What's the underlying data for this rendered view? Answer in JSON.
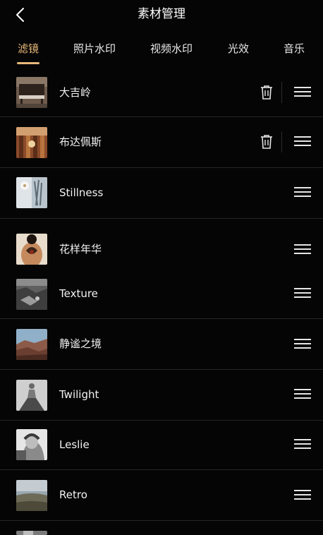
{
  "header": {
    "title": "素材管理"
  },
  "tabs": [
    {
      "label": "滤镜",
      "active": true
    },
    {
      "label": "照片水印",
      "active": false
    },
    {
      "label": "视频水印",
      "active": false
    },
    {
      "label": "光效",
      "active": false
    },
    {
      "label": "音乐",
      "active": false
    }
  ],
  "colors": {
    "accent": "#e8b87a",
    "background": "#050505",
    "divider": "#262626"
  },
  "filters": [
    {
      "name": "大吉岭",
      "deletable": true,
      "thumb": "piano-icon"
    },
    {
      "name": "布达佩斯",
      "deletable": true,
      "thumb": "ornate-hall-icon"
    },
    {
      "name": "Stillness",
      "deletable": false,
      "thumb": "snowy-tree-icon"
    },
    {
      "name": "花样年华",
      "deletable": false,
      "thumb": "tattooed-back-icon"
    },
    {
      "name": "Texture",
      "deletable": false,
      "thumb": "rocky-ground-icon"
    },
    {
      "name": "静谧之境",
      "deletable": false,
      "thumb": "desert-hills-icon"
    },
    {
      "name": "Twilight",
      "deletable": false,
      "thumb": "woman-gown-icon"
    },
    {
      "name": "Leslie",
      "deletable": false,
      "thumb": "bw-portrait-icon"
    },
    {
      "name": "Retro",
      "deletable": false,
      "thumb": "field-landscape-icon"
    }
  ]
}
